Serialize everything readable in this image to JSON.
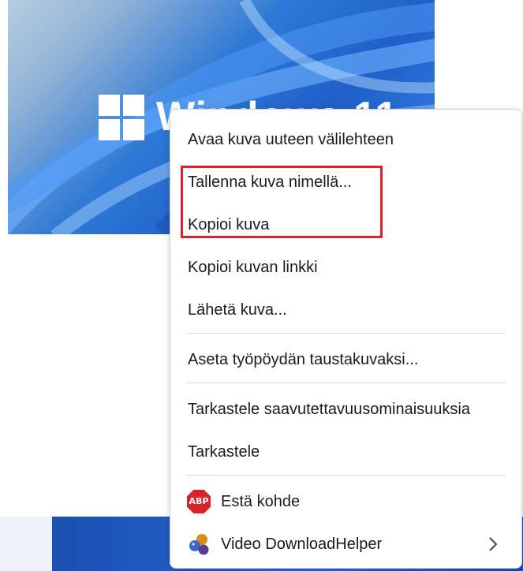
{
  "background": {
    "logo_text": "Windows 11",
    "accent_color": "#1f5fc9"
  },
  "context_menu": {
    "items": [
      {
        "label": "Avaa kuva uuteen välilehteen"
      },
      {
        "label": "Tallenna kuva nimellä..."
      },
      {
        "label": "Kopioi kuva"
      },
      {
        "label": "Kopioi kuvan linkki"
      },
      {
        "label": "Lähetä kuva..."
      },
      {
        "label": "Aseta työpöydän taustakuvaksi..."
      },
      {
        "label": "Tarkastele saavutettavuusominaisuuksia"
      },
      {
        "label": "Tarkastele"
      },
      {
        "label": "Estä kohde",
        "icon": "adblock-plus-icon",
        "icon_text": "ABP"
      },
      {
        "label": "Video DownloadHelper",
        "icon": "video-downloadhelper-icon",
        "submenu": "chevron-right-icon"
      }
    ]
  },
  "annotation": {
    "highlight_color": "#e0202a"
  }
}
